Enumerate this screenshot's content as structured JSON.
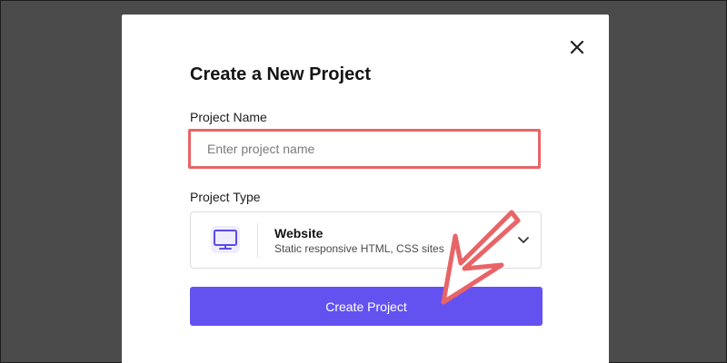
{
  "dialog": {
    "title": "Create a New Project",
    "close_icon": "close-icon"
  },
  "project_name": {
    "label": "Project Name",
    "placeholder": "Enter project name",
    "value": ""
  },
  "project_type": {
    "label": "Project Type",
    "selected": {
      "title": "Website",
      "description": "Static responsive HTML, CSS sites",
      "icon": "monitor-icon"
    },
    "dropdown_icon": "chevron-down-icon"
  },
  "actions": {
    "create_label": "Create Project"
  },
  "annotation": {
    "icon": "arrow-annotation",
    "color": "#e86466"
  },
  "colors": {
    "accent": "#6452f0",
    "highlight": "#e86466",
    "overlay": "#4b4b4b"
  }
}
